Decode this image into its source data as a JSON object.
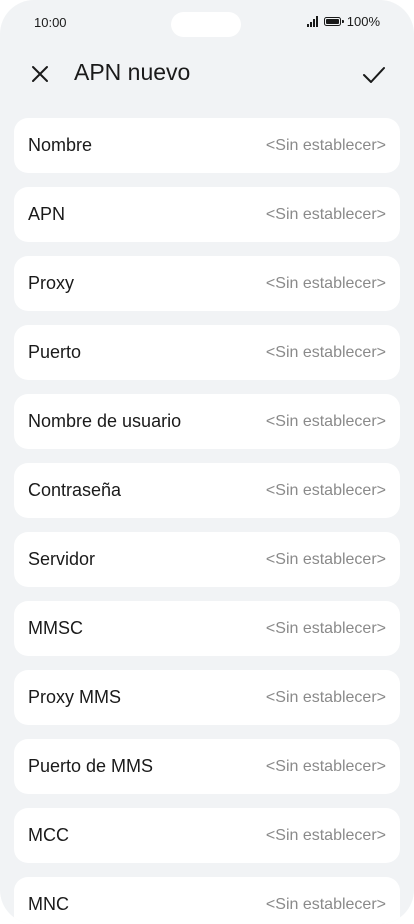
{
  "status_bar": {
    "time": "10:00",
    "battery": "100%",
    "icons": [
      "signal-icon",
      "battery-icon"
    ]
  },
  "header": {
    "title": "APN nuevo",
    "close_icon": "close-icon",
    "confirm_icon": "checkmark-icon"
  },
  "fields": [
    {
      "label": "Nombre",
      "value": "<Sin establecer>"
    },
    {
      "label": "APN",
      "value": "<Sin establecer>"
    },
    {
      "label": "Proxy",
      "value": "<Sin establecer>"
    },
    {
      "label": "Puerto",
      "value": "<Sin establecer>"
    },
    {
      "label": "Nombre de usuario",
      "value": "<Sin establecer>"
    },
    {
      "label": "Contraseña",
      "value": "<Sin establecer>"
    },
    {
      "label": "Servidor",
      "value": "<Sin establecer>"
    },
    {
      "label": "MMSC",
      "value": "<Sin establecer>"
    },
    {
      "label": "Proxy MMS",
      "value": "<Sin establecer>"
    },
    {
      "label": "Puerto de MMS",
      "value": "<Sin establecer>"
    },
    {
      "label": "MCC",
      "value": "<Sin establecer>"
    },
    {
      "label": "MNC",
      "value": "<Sin establecer>"
    }
  ]
}
